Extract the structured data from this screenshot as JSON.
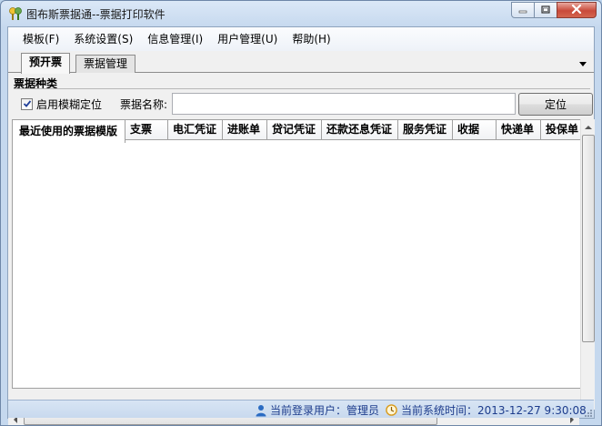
{
  "window": {
    "title": "图布斯票据通--票据打印软件",
    "icon": "app-logo-icon"
  },
  "menu": [
    {
      "label": "模板(F)"
    },
    {
      "label": "系统设置(S)"
    },
    {
      "label": "信息管理(I)"
    },
    {
      "label": "用户管理(U)"
    },
    {
      "label": "帮助(H)"
    }
  ],
  "tabs": [
    {
      "label": "预开票",
      "active": true
    },
    {
      "label": "票据管理",
      "active": false
    }
  ],
  "panel": {
    "group_title": "票据种类",
    "fuzzy_checkbox_label": "启用模糊定位",
    "fuzzy_checked": true,
    "name_label": "票据名称:",
    "name_value": "",
    "locate_button": "定位"
  },
  "grid": {
    "columns": [
      {
        "label": "最近使用的票据模版"
      },
      {
        "label": "支票"
      },
      {
        "label": "电汇凭证"
      },
      {
        "label": "进账单"
      },
      {
        "label": "贷记凭证"
      },
      {
        "label": "还款还息凭证"
      },
      {
        "label": "服务凭证"
      },
      {
        "label": "收据"
      },
      {
        "label": "快递单"
      },
      {
        "label": "投保单"
      }
    ],
    "rows": []
  },
  "status": {
    "user_text": "当前登录用户：管理员",
    "time_text": "当前系统时间：2013-12-27 9:30:08"
  },
  "colors": {
    "status_text": "#1d3c8c",
    "title_bar": "#c5d8ee",
    "close_button": "#c94a3a"
  }
}
